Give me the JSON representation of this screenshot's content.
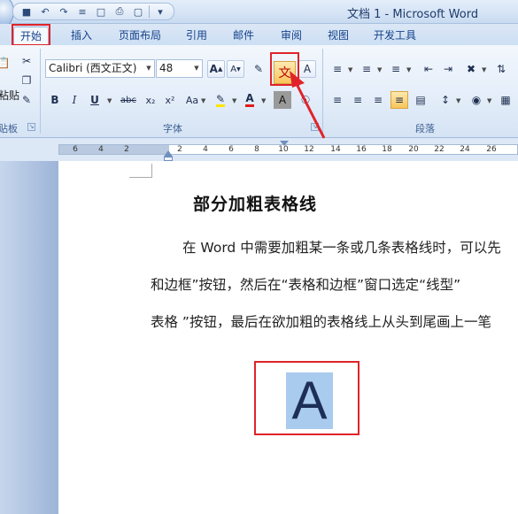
{
  "window": {
    "title": "文档 1 - Microsoft Word"
  },
  "qat": {
    "icons": [
      "word-icon",
      "save-icon",
      "undo-icon",
      "redo-icon",
      "format-icon",
      "preview-icon",
      "print-icon",
      "new-doc-icon",
      "customize-icon"
    ]
  },
  "tabs": [
    "开始",
    "插入",
    "页面布局",
    "引用",
    "邮件",
    "审阅",
    "视图",
    "开发工具"
  ],
  "active_tab": "开始",
  "ribbon": {
    "clipboard": {
      "label": "粘贴",
      "group_label": "贴板"
    },
    "font": {
      "font_name": "Calibri (西文正文)",
      "font_size": "48",
      "group_label": "字体",
      "bold": "B",
      "italic": "I",
      "underline": "U",
      "strike": "abc",
      "subscript": "x₂",
      "superscript": "x²",
      "change_case": "Aa",
      "font_color": "A",
      "grow": "A",
      "shrink": "A",
      "char_border": "A",
      "char_shading": "A",
      "phonetic": "文"
    },
    "paragraph": {
      "group_label": "段落"
    }
  },
  "ruler": {
    "numbers": [
      "6",
      "4",
      "2",
      "2",
      "4",
      "6",
      "8",
      "10",
      "12",
      "14",
      "16",
      "18",
      "20",
      "22",
      "24",
      "26"
    ]
  },
  "document": {
    "title": "部分加粗表格线",
    "paragraphs": [
      "在 Word 中需要加粗某一条或几条表格线时，可以先",
      "和边框”按钮，然后在“表格和边框”窗口选定“线型”",
      "表格 ”按钮，最后在欲加粗的表格线上从头到尾画上一笔"
    ],
    "sample_letter": "A"
  },
  "colors": {
    "highlight": "#e0232a",
    "selection": "#a9cbed",
    "ribbon_text": "#15428b"
  }
}
